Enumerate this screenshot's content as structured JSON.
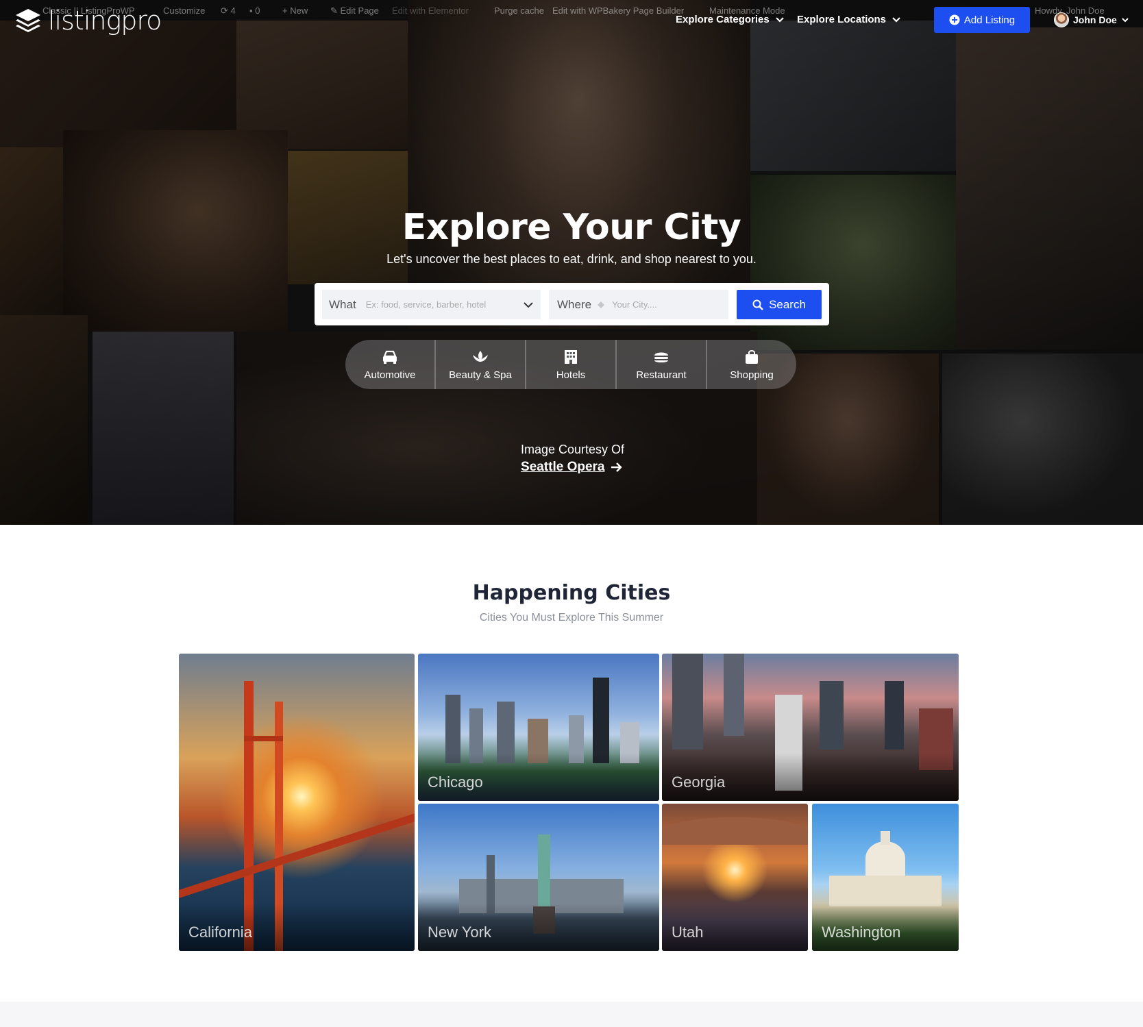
{
  "admin_bar": {
    "site": "Classic || ListingProWP",
    "customize": "Customize",
    "updates": "4",
    "comments": "0",
    "new": "New",
    "edit_page": "Edit Page",
    "edit_elementor": "Edit with Elementor",
    "purge_cache": "Purge cache",
    "edit_wpbakery": "Edit with WPBakery Page Builder",
    "maintenance": "Maintenance Mode",
    "howdy": "Howdy, John Doe"
  },
  "header": {
    "logo_text": "listingpro",
    "nav": [
      {
        "label": "Explore Categories"
      },
      {
        "label": "Explore Locations"
      }
    ],
    "add_listing": "Add Listing",
    "user_name": "John Doe"
  },
  "hero": {
    "title": "Explore Your City",
    "subtitle": "Let's uncover the best places to eat, drink, and shop nearest to you.",
    "search": {
      "what_label": "What",
      "what_placeholder": "Ex: food, service, barber, hotel",
      "where_label": "Where",
      "where_placeholder": "Your City....",
      "button": "Search"
    },
    "categories": [
      {
        "label": "Automotive",
        "icon": "car-icon"
      },
      {
        "label": "Beauty & Spa",
        "icon": "lotus-icon"
      },
      {
        "label": "Hotels",
        "icon": "building-icon"
      },
      {
        "label": "Restaurant",
        "icon": "burger-icon"
      },
      {
        "label": "Shopping",
        "icon": "shopping-bag-icon"
      }
    ],
    "courtesy_text": "Image Courtesy Of",
    "courtesy_link": "Seattle Opera"
  },
  "section": {
    "title": "Happening Cities",
    "subtitle": "Cities You Must Explore This Summer"
  },
  "cities": [
    {
      "name": "California"
    },
    {
      "name": "Chicago"
    },
    {
      "name": "Georgia"
    },
    {
      "name": "New York"
    },
    {
      "name": "Utah"
    },
    {
      "name": "Washington"
    }
  ],
  "colors": {
    "accent": "#1d4ff0",
    "heading": "#1f2436",
    "muted": "#8a8f98"
  }
}
